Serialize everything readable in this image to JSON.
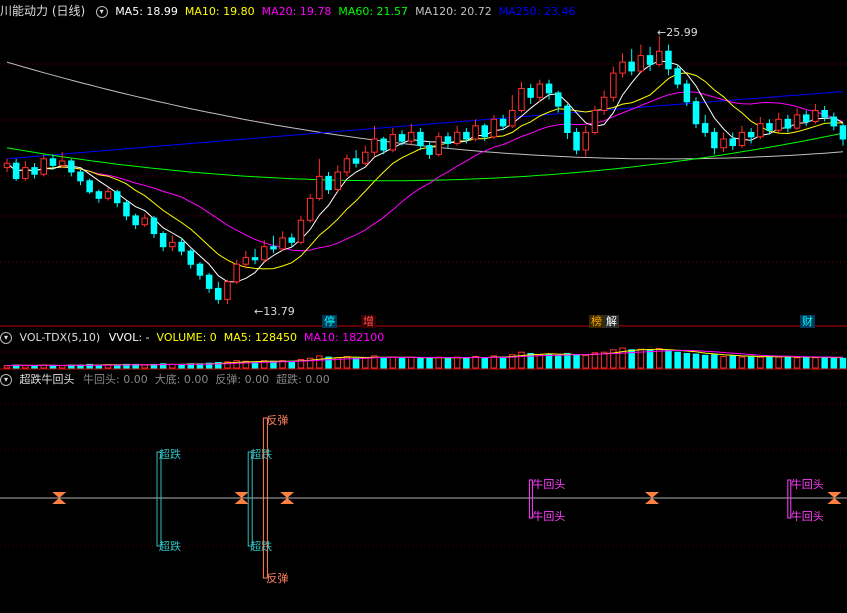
{
  "main": {
    "title": "川能动力 (日线)",
    "ma": [
      {
        "label": "MA5: 18.99",
        "color": "#ffffff"
      },
      {
        "label": "MA10: 19.80",
        "color": "#ffff00"
      },
      {
        "label": "MA20: 19.78",
        "color": "#ff00ff"
      },
      {
        "label": "MA60: 21.57",
        "color": "#00ff00"
      },
      {
        "label": "MA120: 20.72",
        "color": "#c0c0c0"
      },
      {
        "label": "MA250: 23.46",
        "color": "#0000ff"
      }
    ],
    "high_label": "25.99",
    "low_label": "13.79",
    "events": [
      {
        "text": "停",
        "color": "#00ffff",
        "bg": "#003a5a"
      },
      {
        "text": "增",
        "color": "#ff5555",
        "bg": "#3a0000"
      },
      {
        "text": "榜",
        "color": "#ffaa00",
        "bg": "#3a2a00"
      },
      {
        "text": "解",
        "color": "#ffffff",
        "bg": "#2a2a2a"
      },
      {
        "text": "财",
        "color": "#00ffff",
        "bg": "#003a5a"
      }
    ]
  },
  "volume": {
    "title": "VOL-TDX(5,10)",
    "items": [
      {
        "label": "VVOL: -",
        "color": "#ffffff"
      },
      {
        "label": "VOLUME: 0",
        "color": "#ffff00"
      },
      {
        "label": "MA5: 128450",
        "color": "#ffff00"
      },
      {
        "label": "MA10: 182100",
        "color": "#ff00ff"
      }
    ]
  },
  "indicator": {
    "title": "超跌牛回头",
    "items": [
      {
        "label": "牛回头: 0.00",
        "color": "#888888"
      },
      {
        "label": "大底: 0.00",
        "color": "#888888"
      },
      {
        "label": "反弹: 0.00",
        "color": "#888888"
      },
      {
        "label": "超跌: 0.00",
        "color": "#888888"
      }
    ],
    "signals": {
      "chaodie": "超跌",
      "fantan": "反弹",
      "niuhuitou": "牛回头"
    }
  },
  "colors": {
    "up": "#ff3030",
    "down": "#00ffff",
    "bg": "#000000"
  },
  "chart_data": {
    "type": "candlestick",
    "price_range": [
      13.79,
      25.99
    ],
    "high": 25.99,
    "low": 13.79,
    "candles": [
      [
        20.0,
        20.2,
        20.4,
        19.8
      ],
      [
        20.2,
        19.5,
        20.4,
        19.4
      ],
      [
        19.5,
        20.0,
        20.3,
        19.4
      ],
      [
        20.0,
        19.7,
        20.2,
        19.5
      ],
      [
        19.7,
        20.4,
        20.6,
        19.6
      ],
      [
        20.4,
        20.1,
        20.6,
        19.9
      ],
      [
        20.1,
        20.3,
        20.7,
        20.0
      ],
      [
        20.3,
        19.8,
        20.4,
        19.6
      ],
      [
        19.8,
        19.4,
        19.9,
        19.2
      ],
      [
        19.4,
        18.9,
        19.5,
        18.8
      ],
      [
        18.9,
        18.6,
        19.0,
        18.4
      ],
      [
        18.6,
        18.9,
        19.1,
        18.5
      ],
      [
        18.9,
        18.4,
        19.0,
        18.2
      ],
      [
        18.4,
        17.8,
        18.5,
        17.6
      ],
      [
        17.8,
        17.4,
        17.9,
        17.2
      ],
      [
        17.4,
        17.7,
        17.9,
        17.3
      ],
      [
        17.7,
        17.0,
        17.8,
        16.8
      ],
      [
        17.0,
        16.4,
        17.1,
        16.2
      ],
      [
        16.4,
        16.6,
        16.9,
        16.2
      ],
      [
        16.6,
        16.2,
        16.8,
        16.0
      ],
      [
        16.2,
        15.6,
        16.3,
        15.4
      ],
      [
        15.6,
        15.1,
        15.7,
        14.9
      ],
      [
        15.1,
        14.5,
        15.2,
        14.3
      ],
      [
        14.5,
        14.0,
        14.8,
        13.8
      ],
      [
        14.0,
        14.8,
        14.9,
        13.79
      ],
      [
        14.8,
        15.6,
        15.8,
        14.7
      ],
      [
        15.6,
        15.9,
        16.2,
        15.4
      ],
      [
        15.9,
        15.8,
        16.3,
        15.6
      ],
      [
        15.8,
        16.4,
        16.7,
        15.7
      ],
      [
        16.4,
        16.3,
        16.9,
        16.1
      ],
      [
        16.3,
        16.8,
        17.1,
        16.2
      ],
      [
        16.8,
        16.6,
        17.0,
        16.4
      ],
      [
        16.6,
        17.6,
        17.8,
        16.5
      ],
      [
        17.6,
        18.6,
        18.8,
        17.5
      ],
      [
        18.6,
        19.6,
        20.4,
        18.5
      ],
      [
        19.6,
        19.0,
        19.8,
        18.8
      ],
      [
        19.0,
        19.8,
        20.1,
        18.9
      ],
      [
        19.8,
        20.4,
        20.6,
        19.6
      ],
      [
        20.4,
        20.2,
        20.8,
        20.0
      ],
      [
        20.2,
        20.7,
        21.0,
        20.1
      ],
      [
        20.7,
        21.3,
        21.9,
        20.5
      ],
      [
        21.3,
        20.8,
        21.4,
        20.6
      ],
      [
        20.8,
        21.5,
        21.8,
        20.7
      ],
      [
        21.5,
        21.2,
        21.7,
        21.0
      ],
      [
        21.2,
        21.6,
        22.0,
        21.0
      ],
      [
        21.6,
        21.0,
        21.8,
        20.8
      ],
      [
        21.0,
        20.6,
        21.2,
        20.4
      ],
      [
        20.6,
        21.4,
        21.6,
        20.5
      ],
      [
        21.4,
        21.1,
        21.6,
        20.9
      ],
      [
        21.1,
        21.6,
        21.9,
        21.0
      ],
      [
        21.6,
        21.3,
        21.8,
        21.1
      ],
      [
        21.3,
        21.9,
        22.2,
        21.2
      ],
      [
        21.9,
        21.4,
        22.0,
        21.2
      ],
      [
        21.4,
        22.2,
        22.4,
        21.3
      ],
      [
        22.2,
        21.9,
        22.4,
        21.7
      ],
      [
        21.9,
        22.6,
        23.3,
        21.8
      ],
      [
        22.6,
        23.6,
        23.9,
        22.5
      ],
      [
        23.6,
        23.2,
        23.8,
        22.9
      ],
      [
        23.2,
        23.8,
        24.0,
        23.0
      ],
      [
        23.8,
        23.4,
        24.0,
        23.1
      ],
      [
        23.4,
        22.8,
        23.5,
        22.5
      ],
      [
        22.8,
        21.6,
        22.9,
        21.3
      ],
      [
        21.6,
        20.8,
        21.8,
        20.6
      ],
      [
        20.8,
        21.6,
        21.9,
        20.5
      ],
      [
        21.6,
        22.6,
        22.8,
        21.5
      ],
      [
        22.6,
        23.2,
        23.5,
        22.4
      ],
      [
        23.2,
        24.3,
        24.6,
        23.0
      ],
      [
        24.3,
        24.8,
        25.2,
        24.1
      ],
      [
        24.8,
        24.4,
        25.4,
        24.2
      ],
      [
        24.4,
        25.1,
        25.6,
        24.3
      ],
      [
        25.1,
        24.7,
        25.5,
        24.4
      ],
      [
        24.7,
        25.3,
        25.99,
        24.6
      ],
      [
        25.3,
        24.5,
        25.6,
        24.2
      ],
      [
        24.5,
        23.8,
        24.7,
        23.6
      ],
      [
        23.8,
        23.0,
        24.0,
        22.8
      ],
      [
        23.0,
        22.0,
        23.2,
        21.8
      ],
      [
        22.0,
        21.6,
        22.4,
        21.4
      ],
      [
        21.6,
        20.9,
        21.8,
        20.6
      ],
      [
        20.9,
        21.3,
        21.6,
        20.7
      ],
      [
        21.3,
        21.0,
        21.6,
        20.8
      ],
      [
        21.0,
        21.6,
        21.9,
        20.9
      ],
      [
        21.6,
        21.4,
        21.8,
        21.1
      ],
      [
        21.4,
        22.0,
        22.3,
        21.3
      ],
      [
        22.0,
        21.7,
        22.2,
        21.5
      ],
      [
        21.7,
        22.2,
        22.5,
        21.6
      ],
      [
        22.2,
        21.8,
        22.4,
        21.6
      ],
      [
        21.8,
        22.4,
        22.7,
        21.7
      ],
      [
        22.4,
        22.1,
        22.6,
        21.9
      ],
      [
        22.1,
        22.6,
        22.9,
        22.0
      ],
      [
        22.6,
        22.3,
        22.8,
        22.1
      ],
      [
        22.3,
        21.9,
        22.5,
        21.7
      ],
      [
        21.9,
        21.3,
        22.0,
        21.0
      ]
    ],
    "ma_lines": [
      {
        "name": "MA5",
        "color": "#ffffff",
        "last": 18.99
      },
      {
        "name": "MA10",
        "color": "#ffff00",
        "last": 19.8
      },
      {
        "name": "MA20",
        "color": "#ff00ff",
        "last": 19.78
      },
      {
        "name": "MA60",
        "color": "#00ff00",
        "last": 21.57
      },
      {
        "name": "MA120",
        "color": "#c0c0c0",
        "last": 20.72
      },
      {
        "name": "MA250",
        "color": "#0000ff",
        "last": 23.46
      }
    ],
    "volume": [
      4,
      5,
      4,
      4,
      5,
      4,
      4,
      5,
      5,
      6,
      5,
      5,
      5,
      6,
      6,
      5,
      6,
      7,
      6,
      6,
      7,
      7,
      8,
      9,
      10,
      12,
      11,
      10,
      12,
      11,
      12,
      11,
      14,
      16,
      20,
      18,
      17,
      19,
      16,
      17,
      20,
      17,
      18,
      16,
      18,
      17,
      16,
      18,
      16,
      18,
      17,
      19,
      16,
      20,
      18,
      22,
      26,
      24,
      22,
      23,
      20,
      24,
      22,
      21,
      25,
      26,
      30,
      33,
      30,
      31,
      29,
      32,
      29,
      26,
      24,
      23,
      21,
      22,
      19,
      20,
      18,
      19,
      18,
      19,
      18,
      19,
      17,
      18,
      17,
      18,
      17,
      16
    ],
    "signals": [
      {
        "type": "bottom",
        "index": 7
      },
      {
        "type": "chaodie",
        "index": 20
      },
      {
        "type": "bottom",
        "index": 31
      },
      {
        "type": "chaodie",
        "index": 32
      },
      {
        "type": "fantan",
        "index": 34
      },
      {
        "type": "bottom",
        "index": 37
      },
      {
        "type": "niuhuitou",
        "index": 69
      },
      {
        "type": "bottom",
        "index": 85
      },
      {
        "type": "niuhuitou",
        "index": 103
      },
      {
        "type": "bottom",
        "index": 109
      }
    ]
  }
}
